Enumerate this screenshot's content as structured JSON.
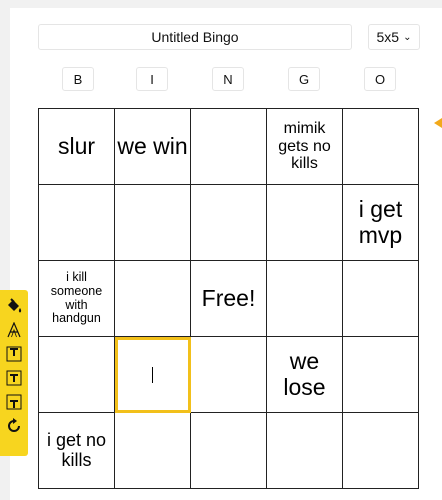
{
  "header": {
    "title_value": "Untitled Bingo",
    "size_selected": "5x5"
  },
  "column_letters": [
    "B",
    "I",
    "N",
    "G",
    "O"
  ],
  "grid": [
    [
      "slur",
      "we win",
      "",
      "mimik gets no kills",
      ""
    ],
    [
      "",
      "",
      "",
      "",
      "i get mvp"
    ],
    [
      "i kill someone with handgun",
      "",
      "Free!",
      "",
      ""
    ],
    [
      "",
      "",
      "",
      "we lose",
      ""
    ],
    [
      "i get no kills",
      "",
      "",
      "",
      ""
    ]
  ],
  "toolbar": {
    "icons": [
      "paint-bucket-icon",
      "font-outline-icon",
      "text-top-icon",
      "text-middle-icon",
      "text-bottom-icon",
      "refresh-icon"
    ]
  },
  "colors": {
    "accent": "#f2c01a",
    "toolbar_bg": "#f7d51f",
    "arrow": "#f2a91a"
  }
}
